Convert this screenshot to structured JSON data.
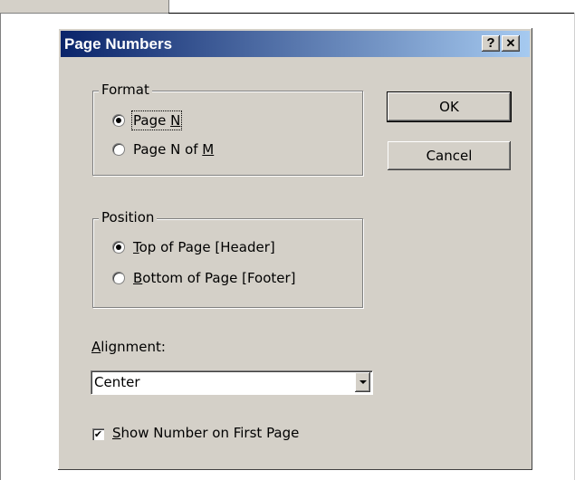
{
  "dialog": {
    "title": "Page Numbers",
    "help_icon": "?",
    "close_icon": "✕"
  },
  "format": {
    "group_label": "Format",
    "options": [
      {
        "label_pre": "Page ",
        "accel": "N",
        "label_post": "",
        "selected": true
      },
      {
        "label_pre": "Page N of ",
        "accel": "M",
        "label_post": "",
        "selected": false
      }
    ]
  },
  "position": {
    "group_label": "Position",
    "options": [
      {
        "label_pre": "",
        "accel": "T",
        "label_post": "op of Page [Header]",
        "selected": true
      },
      {
        "label_pre": "",
        "accel": "B",
        "label_post": "ottom of Page [Footer]",
        "selected": false
      }
    ]
  },
  "buttons": {
    "ok": "OK",
    "cancel": "Cancel"
  },
  "alignment": {
    "label_accel": "A",
    "label_rest": "lignment:",
    "value": "Center"
  },
  "show_first": {
    "accel": "S",
    "label_rest": "how Number on First Page",
    "checked": true,
    "check_glyph": "✔"
  }
}
